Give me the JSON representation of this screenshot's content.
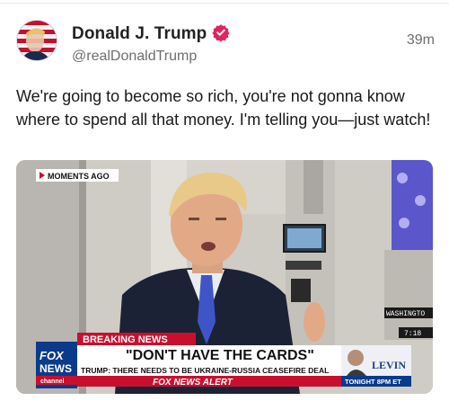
{
  "post": {
    "author": {
      "display_name": "Donald J. Trump",
      "handle": "@realDonaldTrump",
      "verified": true,
      "verified_color": "#e0245e"
    },
    "timestamp": "39m",
    "text": "We're going to become so rich, you're not gonna know where to spend all that money. I'm telling you—just watch!"
  },
  "media": {
    "type": "video-still",
    "overlay": {
      "moments_ago": "MOMENTS AGO",
      "network_logo": "FOX NEWS channel",
      "breaking_label": "BREAKING NEWS",
      "headline": "\"DON'T HAVE THE CARDS\"",
      "subheadline": "TRUMP: THERE NEEDS TO BE UKRAINE-RUSSIA CEASEFIRE DEAL",
      "alert_label": "FOX NEWS ALERT",
      "promo_show": "LEVIN",
      "promo_time": "TONIGHT 8PM ET",
      "location_tag": "WASHINGTO",
      "clock": "7:18"
    }
  }
}
